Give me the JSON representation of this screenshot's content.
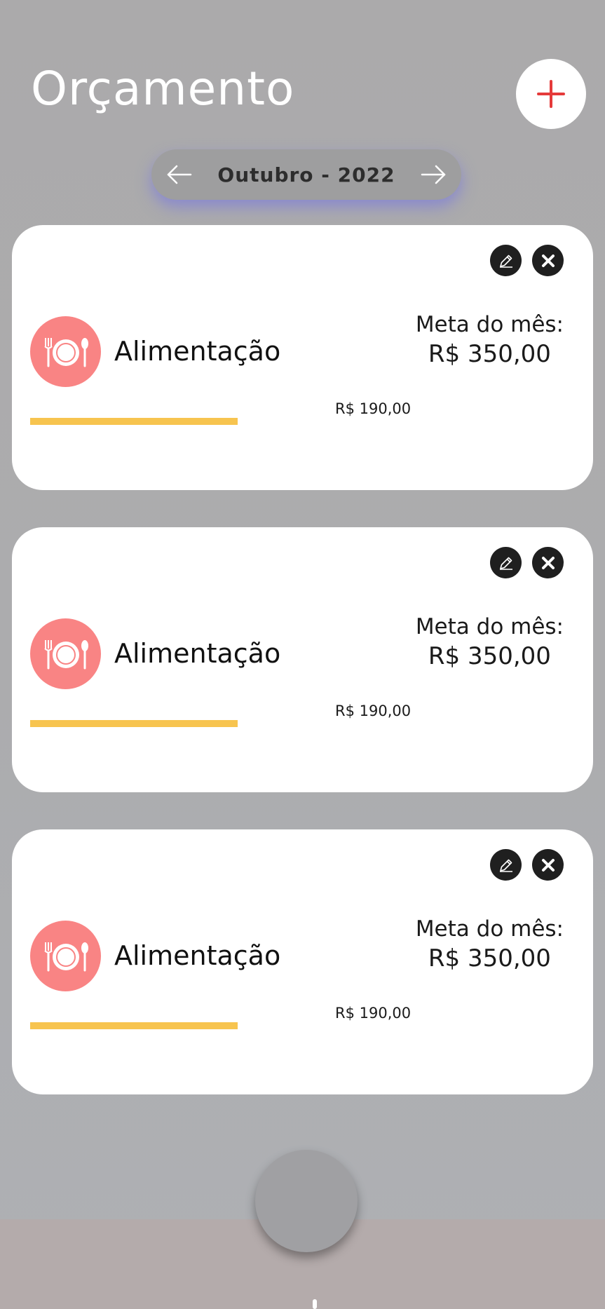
{
  "header": {
    "title": "Orçamento",
    "add_icon": "plus-icon"
  },
  "month_nav": {
    "label": "Outubro - 2022",
    "prev_icon": "arrow-left-icon",
    "next_icon": "arrow-right-icon"
  },
  "colors": {
    "accent": "#e53a3a",
    "category_bg": "#f98484",
    "progress": "#f7c44f",
    "card_bg": "#ffffff"
  },
  "budgets": [
    {
      "category": "Alimentação",
      "icon": "plate-cutlery-icon",
      "goal_label": "Meta do mês:",
      "goal_value": "R$ 350,00",
      "spent": "R$ 190,00",
      "progress_fraction": 0.543
    },
    {
      "category": "Alimentação",
      "icon": "plate-cutlery-icon",
      "goal_label": "Meta do mês:",
      "goal_value": "R$ 350,00",
      "spent": "R$ 190,00",
      "progress_fraction": 0.543
    },
    {
      "category": "Alimentação",
      "icon": "plate-cutlery-icon",
      "goal_label": "Meta do mês:",
      "goal_value": "R$ 350,00",
      "spent": "R$ 190,00",
      "progress_fraction": 0.543
    }
  ]
}
